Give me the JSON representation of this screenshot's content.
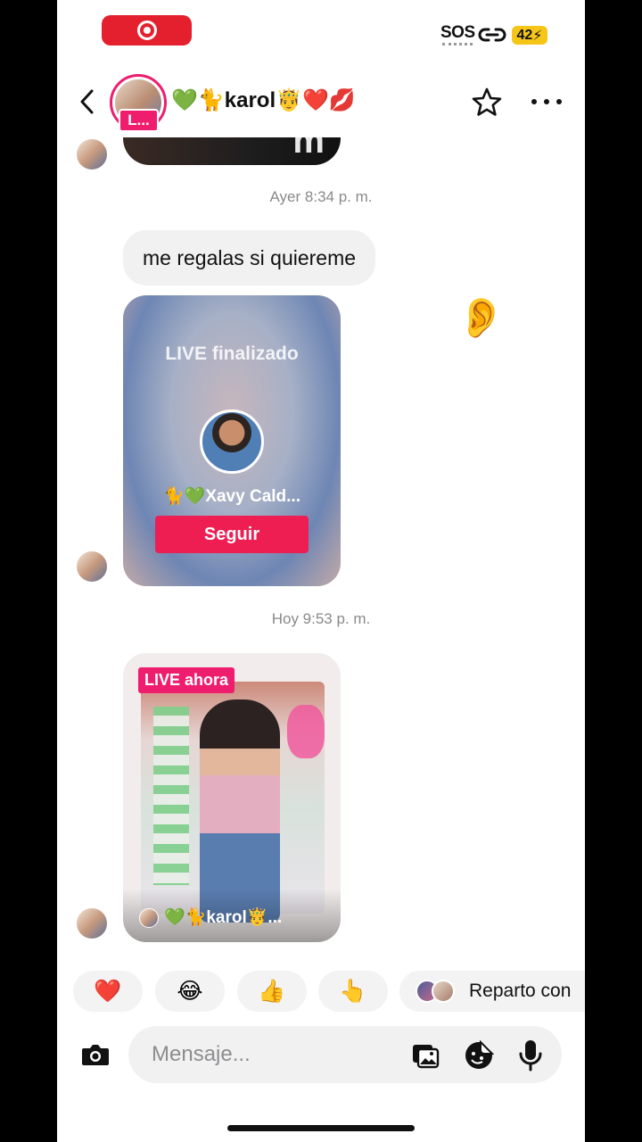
{
  "status_bar": {
    "sos": "SOS",
    "battery": "42",
    "recording_color": "#e5202e",
    "battery_color": "#f5c518"
  },
  "header": {
    "live_badge": "L...",
    "name": "💚🐈karol🤴❤️💋",
    "accent_color": "#ee1d6e"
  },
  "messages": {
    "timestamp_1": "Ayer 8:34 p. m.",
    "bubble_text": "me regalas si quiereme",
    "reaction_emoji": "👂",
    "live_ended_card": {
      "title": "LIVE finalizado",
      "name": "🐈💚Xavy Cald...",
      "follow_label": "Seguir"
    },
    "timestamp_2": "Hoy 9:53 p. m.",
    "live_now_card": {
      "badge": "LIVE ahora",
      "name": "💚🐈karol🤴..."
    }
  },
  "quick_reactions": {
    "items": [
      "❤️",
      "😂",
      "👍",
      "👆"
    ],
    "share_label": "Reparto con"
  },
  "composer": {
    "placeholder": "Mensaje..."
  },
  "icons": [
    "back-icon",
    "star-icon",
    "more-icon",
    "camera-icon",
    "gallery-icon",
    "sticker-icon",
    "mic-icon",
    "link-icon"
  ]
}
